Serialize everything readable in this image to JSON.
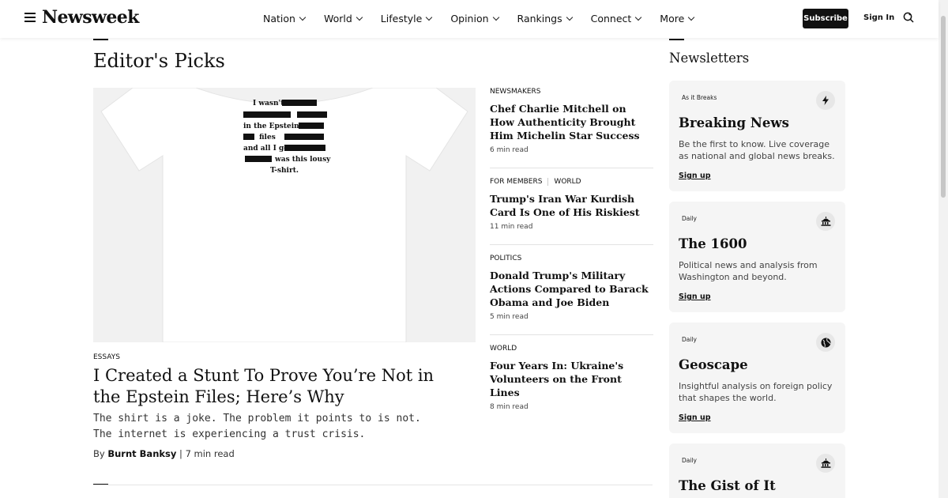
{
  "header": {
    "logo": "Newsweek",
    "nav": [
      {
        "label": "Nation"
      },
      {
        "label": "World"
      },
      {
        "label": "Lifestyle"
      },
      {
        "label": "Opinion"
      },
      {
        "label": "Rankings"
      },
      {
        "label": "Connect"
      },
      {
        "label": "More"
      }
    ],
    "subscribe_label": "Subscribe",
    "signin_label": "Sign In"
  },
  "section": {
    "title": "Editor's Picks"
  },
  "hero": {
    "kicker": "ESSAYS",
    "title": "I Created a Stunt To Prove You’re Not in the Epstein Files; Here’s Why",
    "summary": "The shirt is a joke. The problem it points to is not. The internet is experiencing a trust crisis.",
    "byline_prefix": "By",
    "author": "Burnt Banksy",
    "byline_sep": "|",
    "read_time": "7 min read",
    "shirt_lines": [
      "I wasn't",
      "in the Epstein",
      "files",
      "and all I got",
      "was this lousy",
      "T-shirt."
    ]
  },
  "stories": [
    {
      "kicker": "NEWSMAKERS",
      "kicker2": "",
      "title": "Chef Charlie Mitchell on How Authenticity Brought Him Michelin Star Success",
      "time": "6 min read"
    },
    {
      "kicker": "FOR MEMBERS",
      "kicker2": "WORLD",
      "title": "Trump's Iran War Kurdish Card Is One of His Riskiest",
      "time": "11 min read"
    },
    {
      "kicker": "POLITICS",
      "kicker2": "",
      "title": "Donald Trump's Military Actions Compared to Barack Obama and Joe Biden",
      "time": "5 min read"
    },
    {
      "kicker": "WORLD",
      "kicker2": "",
      "title": "Four Years In: Ukraine's Volunteers on the Front Lines",
      "time": "8 min read"
    }
  ],
  "newsletters": {
    "title": "Newsletters",
    "cards": [
      {
        "freq": "As it Breaks",
        "icon": "lightning-icon",
        "name": "Breaking News",
        "desc": "Be the first to know. Live coverage as national and global news breaks.",
        "signup": "Sign up"
      },
      {
        "freq": "Daily",
        "icon": "capitol-icon",
        "name": "The 1600",
        "desc": "Political news and analysis from Washington and beyond.",
        "signup": "Sign up"
      },
      {
        "freq": "Daily",
        "icon": "globe-icon",
        "name": "Geoscape",
        "desc": "Insightful analysis on foreign policy that shapes the world.",
        "signup": "Sign up"
      },
      {
        "freq": "Daily",
        "icon": "capitol-icon",
        "name": "The Gist of It",
        "desc": "",
        "signup": ""
      }
    ]
  }
}
